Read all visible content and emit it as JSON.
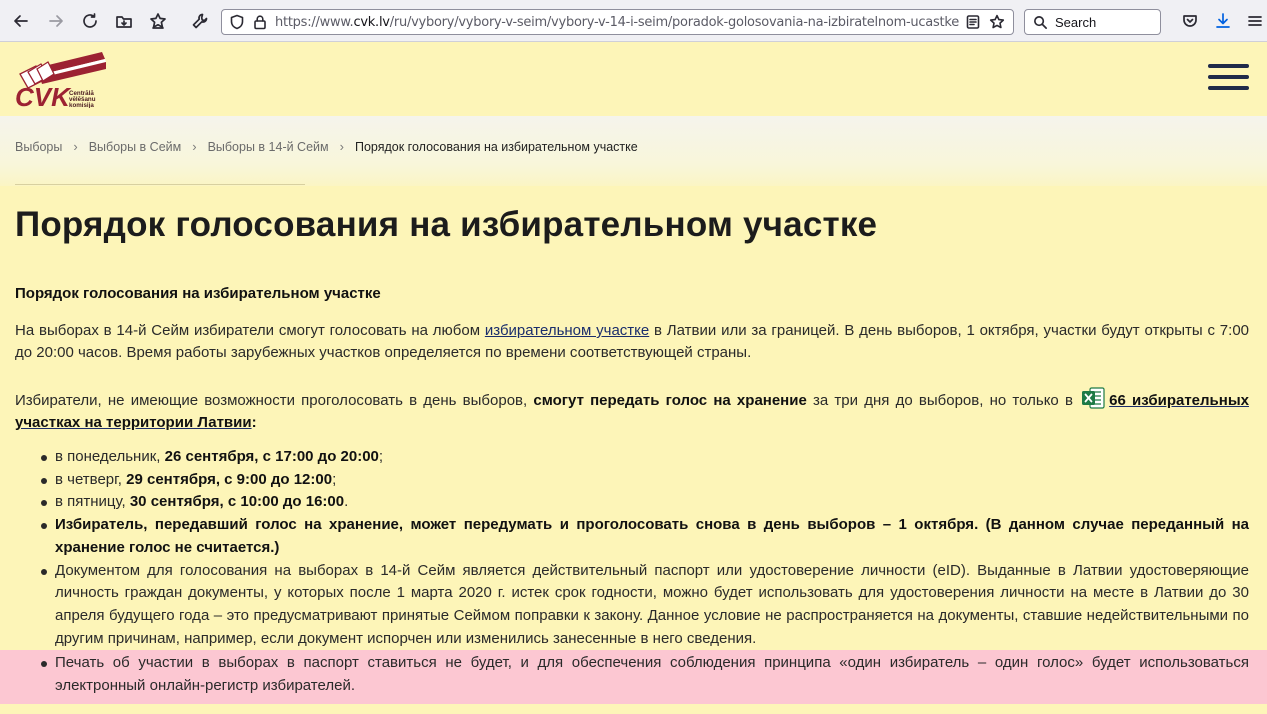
{
  "browser": {
    "url_prefix": "https://www.",
    "url_host": "cvk.lv",
    "url_path": "/ru/vybory/vybory-v-seim/vybory-v-14-i-seim/poradok-golosovania-na-izbiratelnom-ucastke",
    "search_placeholder": "Search"
  },
  "header": {
    "logo_text": "CVK",
    "logo_subtext": [
      "Centrālā",
      "vēlēšanu",
      "komisija"
    ]
  },
  "breadcrumb": {
    "items": [
      "Выборы",
      "Выборы в Сейм",
      "Выборы в 14-й Сейм"
    ],
    "current": "Порядок голосования на избирательном участке"
  },
  "page": {
    "title": "Порядок голосования на избирательном участке",
    "subtitle": "Порядок голосования на избирательном участке",
    "p1_a": "На выборах в 14-й Сейм избиратели смогут голосовать на любом ",
    "p1_link": "избирательном участке",
    "p1_b": " в Латвии или за границей. В день выборов, 1 октября, участки будут открыты с 7:00 до 20:00 часов. Время работы зарубежных участков определяется по времени соответствующей страны.",
    "p2_a": "Избиратели, не имеющие возможности проголосовать в день выборов, ",
    "p2_bold": "смогут передать голос на хранение",
    "p2_b": " за три дня до выборов, но только в ",
    "p2_link": "66 избирательных участках на территории Латвии",
    "p2_c": ":",
    "schedule": [
      {
        "pre": "в понедельник, ",
        "bold": "26 сентября, с 17:00 до 20:00",
        "post": ";"
      },
      {
        "pre": "в четверг, ",
        "bold": "29 сентября, с 9:00 до 12:00",
        "post": ";"
      },
      {
        "pre": "в пятницу, ",
        "bold": "30 сентября, с 10:00 до 16:00",
        "post": "."
      }
    ],
    "notice_bold": "Избиратель, передавший голос на хранение, может передумать и проголосовать снова в день выборов – 1 октября. (В данном случае переданный на хранение голос не считается.)",
    "document_text": "Документом для голосования на выборах в 14-й Сейм является действительный паспорт или удостоверение личности (eID). Выданные в Латвии удостоверяющие личность граждан документы, у которых после 1 марта 2020 г. истек срок годности, можно будет использовать для удостоверения личности на месте в Латвии до 30 апреля будущего года – это предусматривают принятые Сеймом поправки к закону. Данное условие не распространяется на документы, ставшие недействительными по другим причинам, например, если документ испорчен или изменились занесенные в него сведения.",
    "stamp_text": "Печать об участии в выборах в паспорт ставиться не будет, и для обеспечения соблюдения принципа «один избиратель – один голос» будет использоваться электронный онлайн-регистр избирателей."
  },
  "colors": {
    "page_bg": "#fdf5b8",
    "highlight_bg": "#fcc7d2",
    "logo_red": "#9c2232",
    "link": "#1a2d6b",
    "menu_icon": "#1f2a4a"
  }
}
